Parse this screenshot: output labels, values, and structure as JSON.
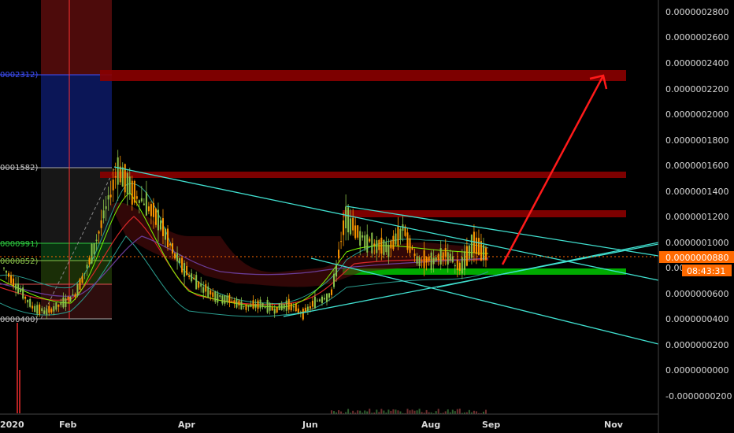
{
  "chart_data": {
    "type": "candlestick",
    "yaxis": {
      "ticks": [
        "0.0000002800",
        "0.0000002600",
        "0.0000002400",
        "0.0000002200",
        "0.0000002000",
        "0.0000001800",
        "0.0000001600",
        "0.0000001400",
        "0.0000001200",
        "0.0000001000",
        "0.0000000800",
        "0.0000000600",
        "0.0000000400",
        "0.0000000200",
        "0.0000000000",
        "-0.0000000200"
      ],
      "ylim": [
        -2e-08,
        2.8e-07
      ]
    },
    "xaxis": {
      "labels": [
        "2020",
        "Feb",
        "Apr",
        "Jun",
        "Aug",
        "Sep",
        "Nov"
      ]
    },
    "current_price": "0.0000000880",
    "countdown": "08:43:31",
    "fib_labels": [
      {
        "text": "0002312)",
        "color": "#3f51ff"
      },
      {
        "text": "0001582)",
        "color": "#c8c8c8"
      },
      {
        "text": "0000991)",
        "color": "#2ecc40"
      },
      {
        "text": "0000852)",
        "color": "#8bc34a"
      },
      {
        "text": "0000400)",
        "color": "#c8c8c8"
      }
    ],
    "resistance_zones": [
      "0.0000002312",
      "0.0000001540",
      "0.0000001230"
    ],
    "support_zone": "0.0000000780",
    "price_series": [
      8e-08,
      6.5e-08,
      5e-08,
      4.6e-08,
      5.2e-08,
      6e-08,
      8.5e-08,
      1.2e-07,
      1.58e-07,
      1.4e-07,
      1.3e-07,
      1.15e-07,
      9e-08,
      7.5e-08,
      6.5e-08,
      5.8e-08,
      5.5e-08,
      5e-08,
      5.2e-08,
      4.8e-08,
      5.2e-08,
      4.5e-08,
      5.5e-08,
      6e-08,
      1.2e-07,
      1.05e-07,
      9.8e-08,
      9.5e-08,
      1.1e-07,
      8.8e-08,
      8.5e-08,
      9.2e-08,
      8e-08,
      1e-07,
      8.8e-08
    ],
    "colors": {
      "candle_up": "#8bc34a",
      "candle_down": "#ff9800",
      "trendline": "#40e0d0",
      "resistance": "#8b0000",
      "support": "#00c800",
      "arrow": "#ff1a1a",
      "price_badge": "#ff6a00"
    }
  }
}
